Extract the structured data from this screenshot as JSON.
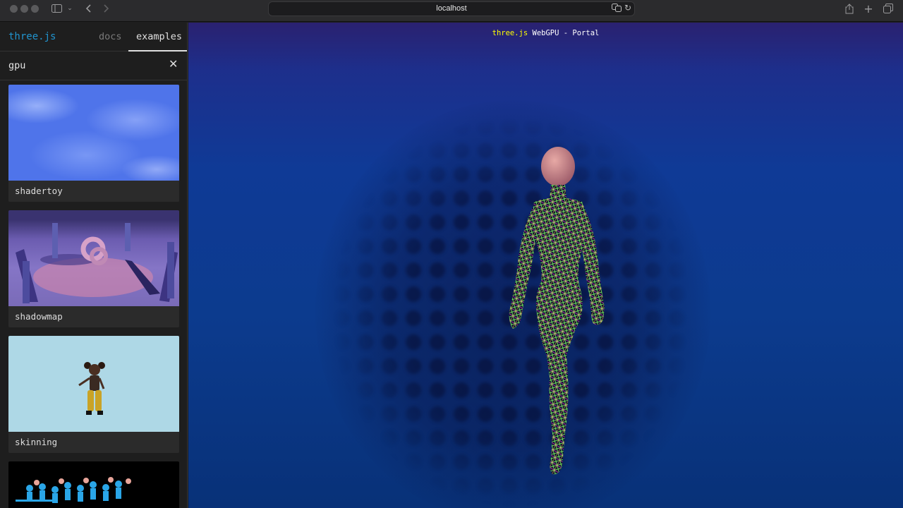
{
  "browser": {
    "url": "localhost",
    "icons": [
      "sidebar-icon",
      "chevron-down-icon",
      "back-icon",
      "forward-icon",
      "translate-icon",
      "reload-icon",
      "share-icon",
      "new-tab-icon",
      "tabs-overview-icon"
    ]
  },
  "sidebar": {
    "logo": "three.js",
    "tabs": [
      {
        "label": "docs",
        "active": false
      },
      {
        "label": "examples",
        "active": true
      }
    ],
    "search": {
      "value": "gpu"
    },
    "examples": [
      {
        "label": "shadertoy"
      },
      {
        "label": "shadowmap"
      },
      {
        "label": "skinning"
      },
      {
        "label": ""
      }
    ]
  },
  "viewport": {
    "info_brand": "three.js",
    "info_title": " WebGPU - Portal"
  },
  "colors": {
    "accent": "#2194ce",
    "info_highlight": "#ffff00",
    "viewport_bg": "#0c3b8e"
  }
}
